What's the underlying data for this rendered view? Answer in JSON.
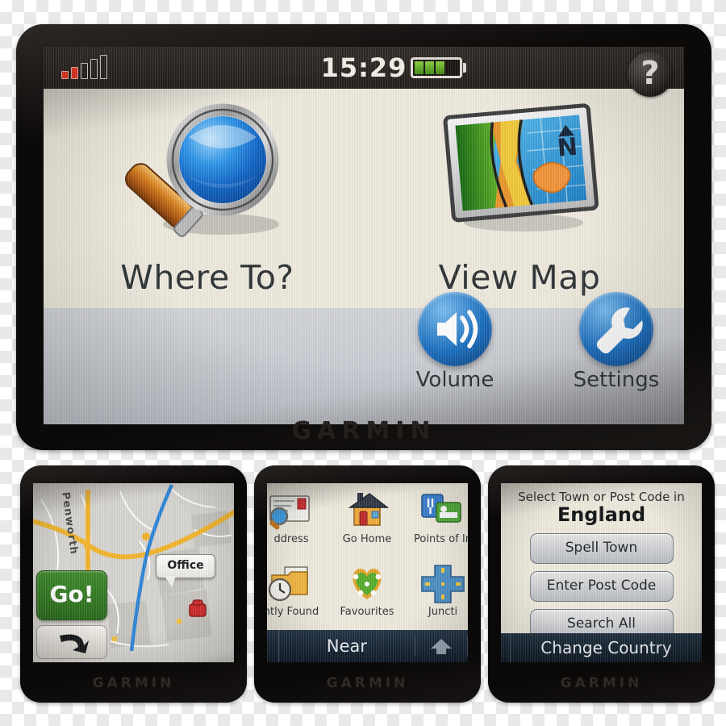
{
  "brand": "GARMIN",
  "main_device": {
    "status_bar": {
      "signal_icon": "signal-bars-icon",
      "signal_bars_total": 5,
      "signal_bars_active": 2,
      "time": "15:29",
      "battery_icon": "battery-icon",
      "battery_segments": 3,
      "help_label": "?"
    },
    "tiles": [
      {
        "id": "where-to",
        "label": "Where To?",
        "icon": "magnifying-glass-icon"
      },
      {
        "id": "view-map",
        "label": "View Map",
        "icon": "map-icon"
      }
    ],
    "small_tiles": [
      {
        "id": "volume",
        "label": "Volume",
        "icon": "speaker-icon"
      },
      {
        "id": "settings",
        "label": "Settings",
        "icon": "wrench-icon"
      }
    ]
  },
  "panel_map": {
    "road_label": "Penworth",
    "go_label": "Go!",
    "back_icon": "back-arrow-icon",
    "callout_label": "Office",
    "poi_icon": "telephone-icon"
  },
  "panel_menu": {
    "items": [
      {
        "label": "ddress",
        "icon": "address-envelope-icon"
      },
      {
        "label": "Go Home",
        "icon": "house-icon"
      },
      {
        "label": "Points of In",
        "icon": "points-of-interest-icon"
      },
      {
        "label": "ntly Found",
        "icon": "recent-clock-folder-icon"
      },
      {
        "label": "Favourites",
        "icon": "heart-icon"
      },
      {
        "label": "Juncti",
        "icon": "junction-icon"
      }
    ],
    "near_label": "Near",
    "up_icon": "up-arrow-icon"
  },
  "panel_select": {
    "title": "Select Town or Post Code in",
    "country": "England",
    "buttons": [
      {
        "label": "Spell Town"
      },
      {
        "label": "Enter Post Code"
      },
      {
        "label": "Search All"
      }
    ],
    "change_country_label": "Change Country"
  }
}
